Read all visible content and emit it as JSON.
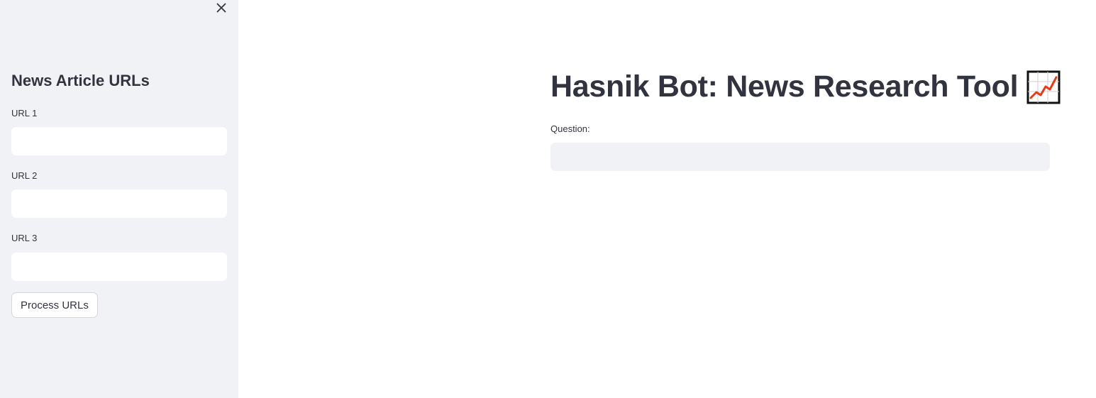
{
  "sidebar": {
    "close_icon": "close-icon",
    "title": "News Article URLs",
    "fields": [
      {
        "label": "URL 1",
        "value": ""
      },
      {
        "label": "URL 2",
        "value": ""
      },
      {
        "label": "URL 3",
        "value": ""
      }
    ],
    "process_button_label": "Process URLs",
    "background_color": "#f0f2f6"
  },
  "main": {
    "title": "Hasnik Bot: News Research Tool",
    "title_icon": "chart-increasing-icon",
    "question_label": "Question:",
    "question_value": ""
  },
  "colors": {
    "text": "#31333f",
    "chart_line": "#e8391a"
  }
}
